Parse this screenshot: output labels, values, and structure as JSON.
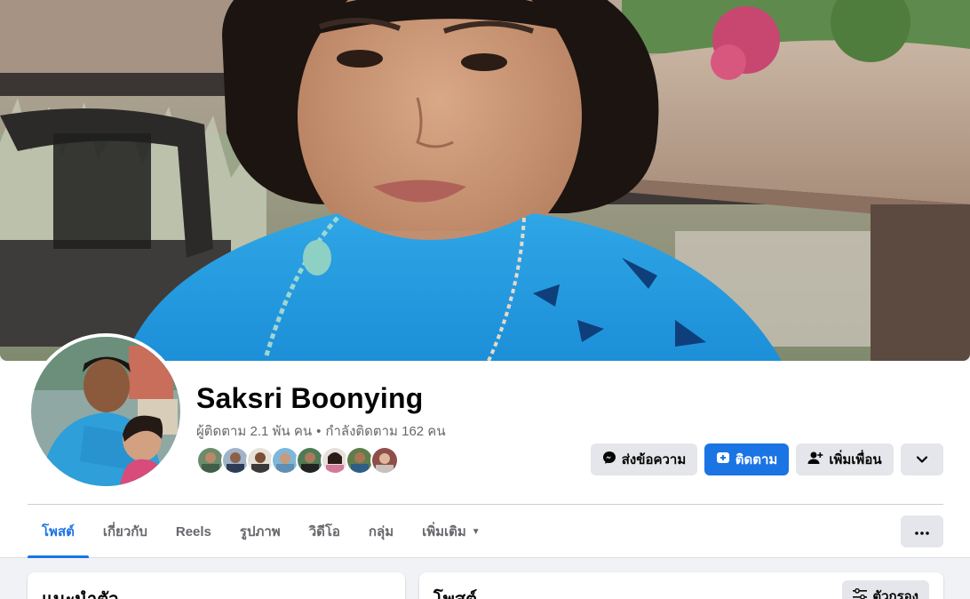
{
  "profile": {
    "name": "Saksri Boonying",
    "followers_text": "ผู้ติดตาม 2.1 พัน คน",
    "separator": "•",
    "following_text": "กำลังติดตาม 162 คน",
    "friend_avatar_count": 8
  },
  "actions": {
    "message_label": "ส่งข้อความ",
    "follow_label": "ติดตาม",
    "add_friend_label": "เพิ่มเพื่อน"
  },
  "tabs": [
    {
      "label": "โพสต์",
      "active": true
    },
    {
      "label": "เกี่ยวกับ",
      "active": false
    },
    {
      "label": "Reels",
      "active": false
    },
    {
      "label": "รูปภาพ",
      "active": false
    },
    {
      "label": "วิดีโอ",
      "active": false
    },
    {
      "label": "กลุ่ม",
      "active": false
    },
    {
      "label": "เพิ่มเติม",
      "active": false
    }
  ],
  "panels": {
    "intro_title": "แนะนำตัว",
    "posts_title": "โพสต์",
    "filter_label": "ตัวกรอง"
  },
  "colors": {
    "accent": "#1b74e4",
    "button_grey": "#e4e6eb",
    "secondary_text": "#65676b"
  },
  "icons": [
    "messenger-icon",
    "follow-icon",
    "add-friend-icon",
    "chevron-down-icon",
    "more-dots-icon",
    "filter-icon"
  ]
}
